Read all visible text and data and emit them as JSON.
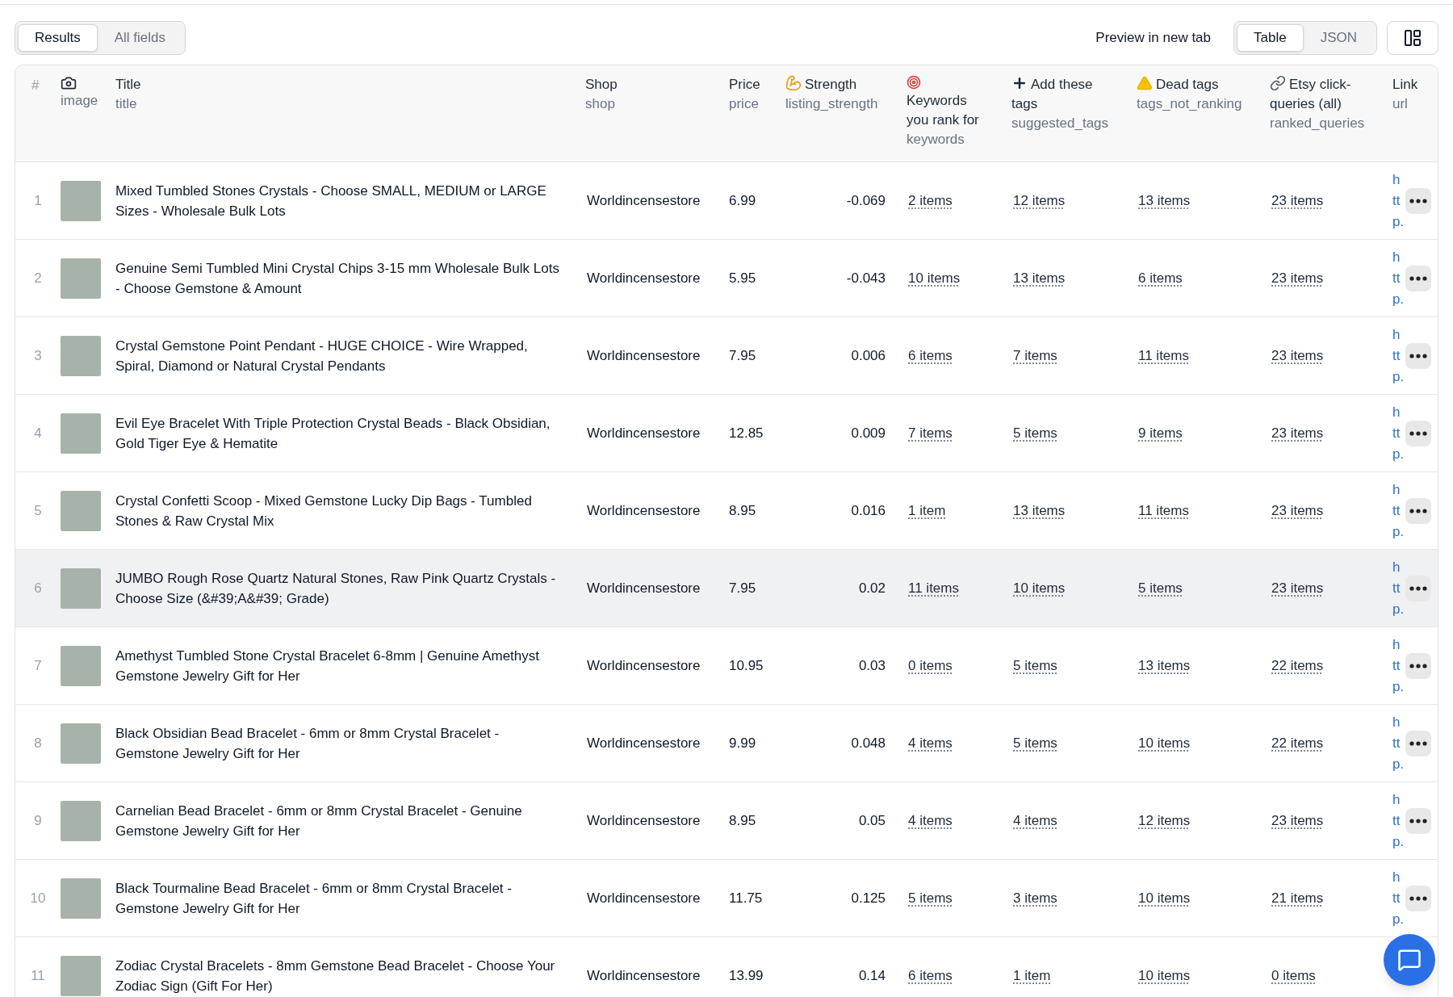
{
  "view_tabs": [
    {
      "label": "Results",
      "selected": true
    },
    {
      "label": "All fields",
      "selected": false
    }
  ],
  "preview_link": "Preview in new tab",
  "format_tabs": [
    {
      "label": "Table",
      "selected": true
    },
    {
      "label": "JSON",
      "selected": false
    }
  ],
  "table": {
    "columns": [
      {
        "kind": "number",
        "label": "#"
      },
      {
        "kind": "image",
        "field": "image"
      },
      {
        "kind": "text",
        "label": "Title",
        "field": "title"
      },
      {
        "kind": "text",
        "label": "Shop",
        "field": "shop"
      },
      {
        "kind": "text",
        "label": "Price",
        "field": "price"
      },
      {
        "kind": "strength",
        "label": "Strength",
        "field": "listing_strength"
      },
      {
        "kind": "keywords",
        "label": "Keywords you rank for",
        "field": "keywords"
      },
      {
        "kind": "add",
        "label": "Add these tags",
        "field": "suggested_tags"
      },
      {
        "kind": "dead",
        "label": "Dead tags",
        "field": "tags_not_ranking"
      },
      {
        "kind": "etsy",
        "label": "Etsy click-queries (all)",
        "field": "ranked_queries"
      },
      {
        "kind": "text",
        "label": "Link",
        "field": "url"
      }
    ],
    "rows": [
      {
        "n": "1",
        "title": "Mixed Tumbled Stones Crystals - Choose SMALL, MEDIUM or LARGE Sizes - Wholesale Bulk Lots",
        "shop": "Worldincensestore",
        "price": "6.99",
        "strength": "-0.069",
        "keywords": "2 items",
        "suggested": "12 items",
        "dead": "13 items",
        "queries": "23 items",
        "link": "http.",
        "highlighted": false
      },
      {
        "n": "2",
        "title": "Genuine Semi Tumbled Mini Crystal Chips 3-15 mm Wholesale Bulk Lots - Choose Gemstone & Amount",
        "shop": "Worldincensestore",
        "price": "5.95",
        "strength": "-0.043",
        "keywords": "10 items",
        "suggested": "13 items",
        "dead": "6 items",
        "queries": "23 items",
        "link": "http.",
        "highlighted": false
      },
      {
        "n": "3",
        "title": "Crystal Gemstone Point Pendant - HUGE CHOICE - Wire Wrapped, Spiral, Diamond or Natural Crystal Pendants",
        "shop": "Worldincensestore",
        "price": "7.95",
        "strength": "0.006",
        "keywords": "6 items",
        "suggested": "7 items",
        "dead": "11 items",
        "queries": "23 items",
        "link": "http.",
        "highlighted": false
      },
      {
        "n": "4",
        "title": "Evil Eye Bracelet With Triple Protection Crystal Beads - Black Obsidian, Gold Tiger Eye & Hematite",
        "shop": "Worldincensestore",
        "price": "12.85",
        "strength": "0.009",
        "keywords": "7 items",
        "suggested": "5 items",
        "dead": "9 items",
        "queries": "23 items",
        "link": "http.",
        "highlighted": false
      },
      {
        "n": "5",
        "title": "Crystal Confetti Scoop - Mixed Gemstone Lucky Dip Bags - Tumbled Stones & Raw Crystal Mix",
        "shop": "Worldincensestore",
        "price": "8.95",
        "strength": "0.016",
        "keywords": "1 item",
        "suggested": "13 items",
        "dead": "11 items",
        "queries": "23 items",
        "link": "http.",
        "highlighted": false
      },
      {
        "n": "6",
        "title": "JUMBO Rough Rose Quartz Natural Stones, Raw Pink Quartz Crystals - Choose Size (&#39;A&#39; Grade)",
        "shop": "Worldincensestore",
        "price": "7.95",
        "strength": "0.02",
        "keywords": "11 items",
        "suggested": "10 items",
        "dead": "5 items",
        "queries": "23 items",
        "link": "http.",
        "highlighted": true
      },
      {
        "n": "7",
        "title": "Amethyst Tumbled Stone Crystal Bracelet 6-8mm | Genuine Amethyst Gemstone Jewelry Gift for Her",
        "shop": "Worldincensestore",
        "price": "10.95",
        "strength": "0.03",
        "keywords": "0 items",
        "suggested": "5 items",
        "dead": "13 items",
        "queries": "22 items",
        "link": "http.",
        "highlighted": false
      },
      {
        "n": "8",
        "title": "Black Obsidian Bead Bracelet - 6mm or 8mm Crystal Bracelet - Gemstone Jewelry Gift for Her",
        "shop": "Worldincensestore",
        "price": "9.99",
        "strength": "0.048",
        "keywords": "4 items",
        "suggested": "5 items",
        "dead": "10 items",
        "queries": "22 items",
        "link": "http.",
        "highlighted": false
      },
      {
        "n": "9",
        "title": "Carnelian Bead Bracelet - 6mm or 8mm Crystal Bracelet - Genuine Gemstone Jewelry Gift for Her",
        "shop": "Worldincensestore",
        "price": "8.95",
        "strength": "0.05",
        "keywords": "4 items",
        "suggested": "4 items",
        "dead": "12 items",
        "queries": "23 items",
        "link": "http.",
        "highlighted": false
      },
      {
        "n": "10",
        "title": "Black Tourmaline Bead Bracelet - 6mm or 8mm Crystal Bracelet - Gemstone Jewelry Gift for Her",
        "shop": "Worldincensestore",
        "price": "11.75",
        "strength": "0.125",
        "keywords": "5 items",
        "suggested": "3 items",
        "dead": "10 items",
        "queries": "21 items",
        "link": "http.",
        "highlighted": false
      },
      {
        "n": "11",
        "title": "Zodiac Crystal Bracelets - 8mm Gemstone Bead Bracelet - Choose Your Zodiac Sign (Gift For Her)",
        "shop": "Worldincensestore",
        "price": "13.99",
        "strength": "0.14",
        "keywords": "6 items",
        "suggested": "1 item",
        "dead": "10 items",
        "queries": "0 items",
        "highlighted": false
      }
    ]
  }
}
